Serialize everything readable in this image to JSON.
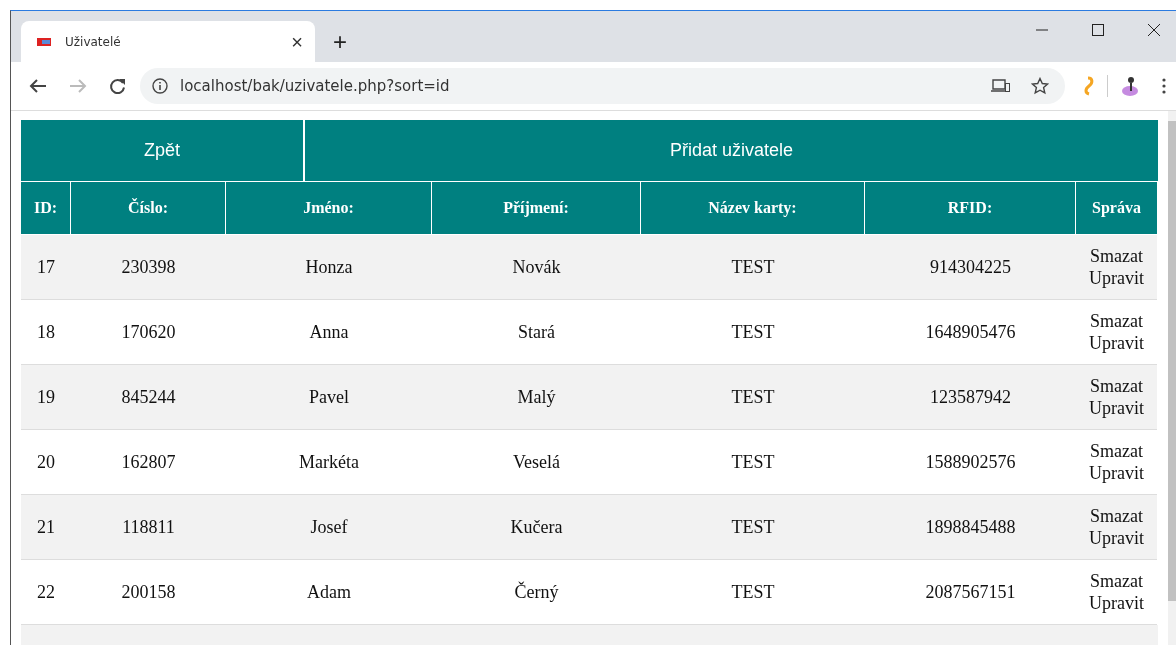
{
  "browser": {
    "tab": {
      "title": "Uživatelé",
      "close": "×"
    },
    "new_tab": "+",
    "address": "localhost/bak/uzivatele.php?sort=id"
  },
  "actions": [
    {
      "label": "Zpět"
    },
    {
      "label": "Přidat uživatele"
    }
  ],
  "table": {
    "columns": [
      "ID:",
      "Číslo:",
      "Jméno:",
      "Příjmení:",
      "Název karty:",
      "RFID:",
      "Správa"
    ],
    "rows": [
      {
        "cells": [
          "17",
          "230398",
          "Honza",
          "Novák",
          "TEST",
          "914304225"
        ],
        "links": [
          "Smazat",
          "Upravit"
        ]
      },
      {
        "cells": [
          "18",
          "170620",
          "Anna",
          "Stará",
          "TEST",
          "1648905476"
        ],
        "links": [
          "Smazat",
          "Upravit"
        ]
      },
      {
        "cells": [
          "19",
          "845244",
          "Pavel",
          "Malý",
          "TEST",
          "123587942"
        ],
        "links": [
          "Smazat",
          "Upravit"
        ]
      },
      {
        "cells": [
          "20",
          "162807",
          "Markéta",
          "Veselá",
          "TEST",
          "1588902576"
        ],
        "links": [
          "Smazat",
          "Upravit"
        ]
      },
      {
        "cells": [
          "21",
          "118811",
          "Josef",
          "Kučera",
          "TEST",
          "1898845488"
        ],
        "links": [
          "Smazat",
          "Upravit"
        ]
      },
      {
        "cells": [
          "22",
          "200158",
          "Adam",
          "Černý",
          "TEST",
          "2087567151"
        ],
        "links": [
          "Smazat",
          "Upravit"
        ]
      }
    ]
  }
}
